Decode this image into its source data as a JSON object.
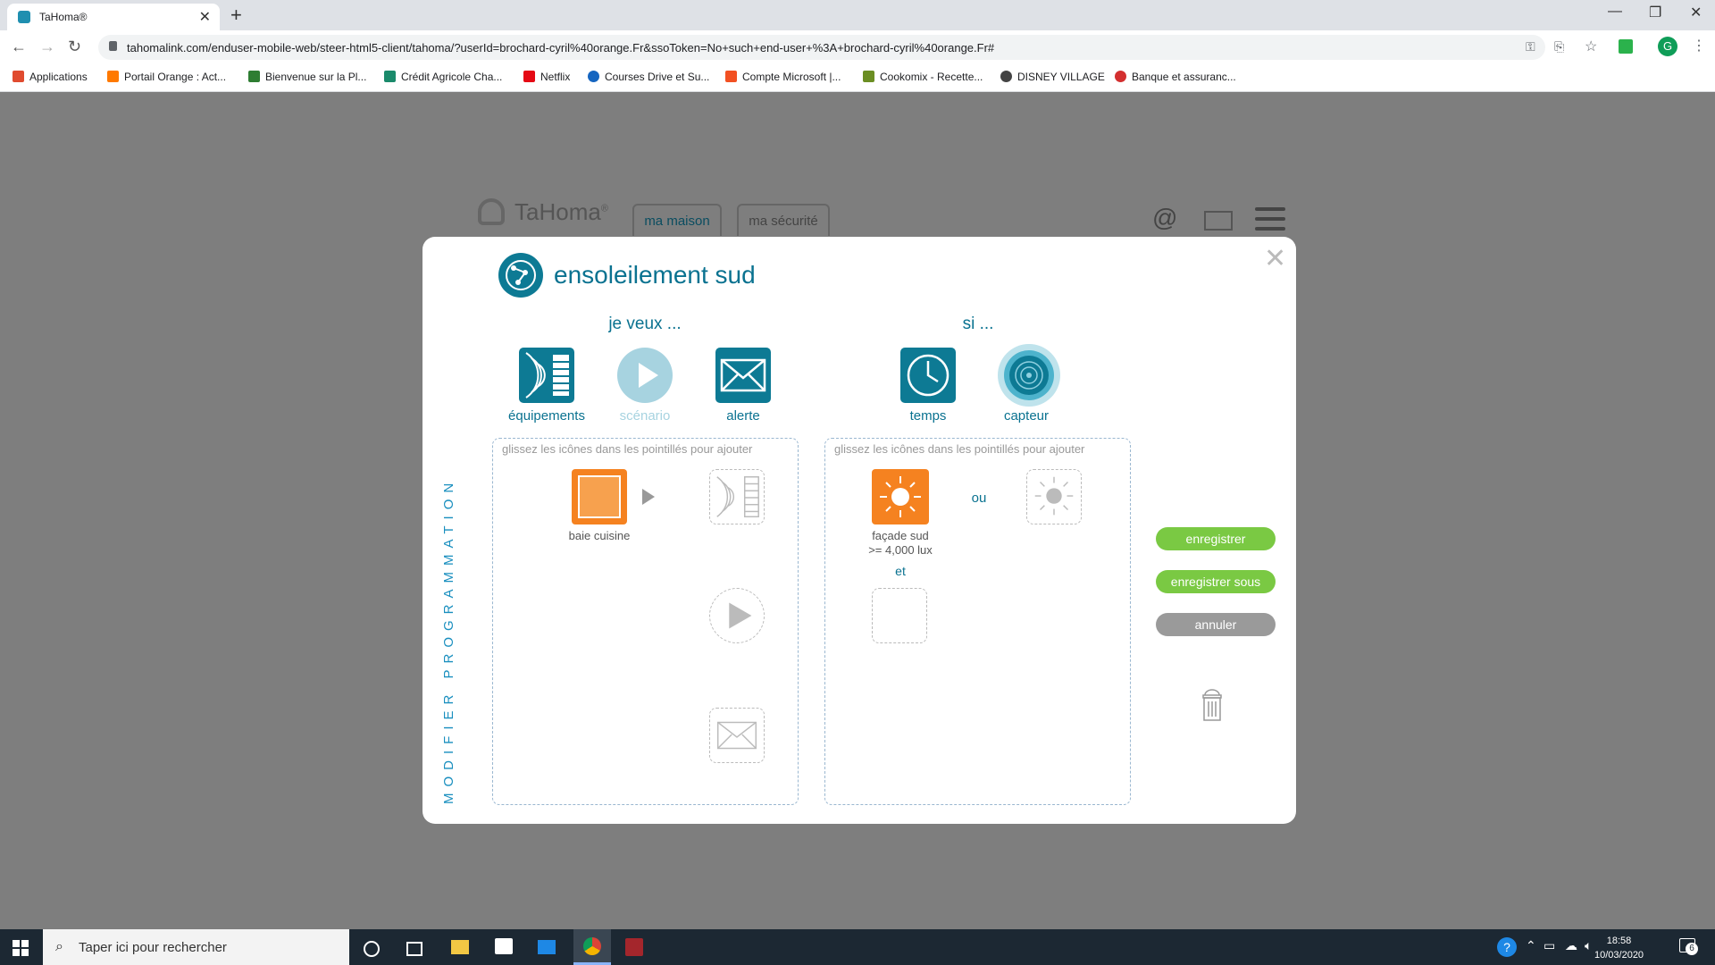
{
  "browser": {
    "tab_title": "TaHoma®",
    "url": "tahomalink.com/enduser-mobile-web/steer-html5-client/tahoma/?userId=brochard-cyril%40orange.Fr&ssoToken=No+such+end-user+%3A+brochard-cyril%40orange.Fr#",
    "bookmarks": [
      {
        "label": "Applications",
        "color": "#e04b2f"
      },
      {
        "label": "Portail Orange : Act...",
        "color": "#ff7900"
      },
      {
        "label": "Bienvenue sur la Pl...",
        "color": "#2e7d32"
      },
      {
        "label": "Crédit Agricole Cha...",
        "color": "#1a8a6b"
      },
      {
        "label": "Netflix",
        "color": "#e50914"
      },
      {
        "label": "Courses Drive et Su...",
        "color": "#1565c0"
      },
      {
        "label": "Compte Microsoft |...",
        "color": "#f25022"
      },
      {
        "label": "Cookomix - Recette...",
        "color": "#6b8e23"
      },
      {
        "label": "DISNEY VILLAGE",
        "color": "#444444"
      },
      {
        "label": "Banque et assuranc...",
        "color": "#d32f2f"
      }
    ],
    "profile_initial": "G"
  },
  "app": {
    "brand": "TaHoma",
    "brand_mark": "®",
    "tabs": [
      "ma maison",
      "ma sécurité"
    ]
  },
  "modal": {
    "title": "ensoleilement sud",
    "vertical_label": "MODIFIER PROGRAMMATION",
    "want_title": "je veux ...",
    "if_title": "si ...",
    "want_tools": [
      {
        "label": "équipements",
        "icon": "equipment-icon",
        "color": "#0d7a94"
      },
      {
        "label": "scénario",
        "icon": "play-icon",
        "color": "#a7d3e0"
      },
      {
        "label": "alerte",
        "icon": "mail-icon",
        "color": "#0d7a94"
      }
    ],
    "if_tools": [
      {
        "label": "temps",
        "icon": "clock-icon",
        "color": "#0d7a94"
      },
      {
        "label": "capteur",
        "icon": "sensor-icon",
        "color": "#0d7a94"
      }
    ],
    "drop_hint": "glissez les icônes dans les pointillés pour ajouter",
    "actions_item": "baie cuisine",
    "sensor_item": "façade sud",
    "sensor_value": ">= 4,000 lux",
    "or_label": "ou",
    "and_label": "et",
    "buttons": {
      "save": "enregistrer",
      "save_as": "enregistrer sous",
      "cancel": "annuler"
    },
    "accent_color": "#0a7290",
    "orange_color": "#f58220",
    "green_color": "#7ac943"
  },
  "taskbar": {
    "search_placeholder": "Taper ici pour rechercher",
    "time": "18:58",
    "date": "10/03/2020",
    "notification_count": "6"
  }
}
